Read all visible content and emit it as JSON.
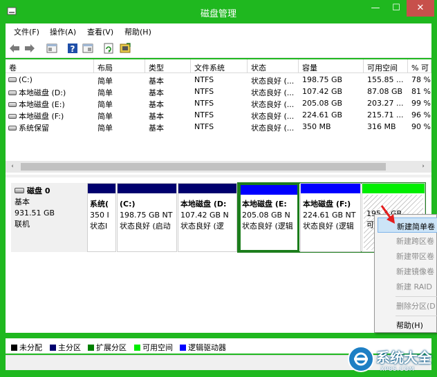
{
  "window": {
    "title": "磁盘管理",
    "controls": {
      "minimize": "—",
      "maximize": "☐",
      "close": "✕"
    }
  },
  "menu": [
    "文件(F)",
    "操作(A)",
    "查看(V)",
    "帮助(H)"
  ],
  "toolbar": {
    "icons": [
      "back-icon",
      "forward-icon",
      "properties-icon",
      "help-icon",
      "view-icon",
      "refresh-icon",
      "disk-wizard-icon"
    ]
  },
  "volume_table": {
    "headers": [
      "卷",
      "布局",
      "类型",
      "文件系统",
      "状态",
      "容量",
      "可用空间",
      "% 可"
    ],
    "rows": [
      [
        "(C:)",
        "简单",
        "基本",
        "NTFS",
        "状态良好 (...",
        "198.75 GB",
        "155.85 ...",
        "78 %"
      ],
      [
        "本地磁盘 (D:)",
        "简单",
        "基本",
        "NTFS",
        "状态良好 (...",
        "107.42 GB",
        "87.08 GB",
        "81 %"
      ],
      [
        "本地磁盘 (E:)",
        "简单",
        "基本",
        "NTFS",
        "状态良好 (...",
        "205.08 GB",
        "203.27 ...",
        "99 %"
      ],
      [
        "本地磁盘 (F:)",
        "简单",
        "基本",
        "NTFS",
        "状态良好 (...",
        "224.61 GB",
        "215.71 ...",
        "96 %"
      ],
      [
        "系统保留",
        "简单",
        "基本",
        "NTFS",
        "状态良好 (...",
        "350 MB",
        "316 MB",
        "90 %"
      ]
    ]
  },
  "scrollbar": {
    "left_arrow": "‹",
    "right_arrow": "›"
  },
  "disk": {
    "name": "磁盘 0",
    "type": "基本",
    "size": "931.51 GB",
    "status": "联机"
  },
  "partitions": [
    {
      "name": "系统(",
      "size": "350 I",
      "status": "状态Ⅰ",
      "bar_color": "#00006e"
    },
    {
      "name": "(C:)",
      "size": "198.75 GB NT",
      "status": "状态良好 (启动",
      "bar_color": "#00006e"
    },
    {
      "name": "本地磁盘 (D:",
      "size": "107.42 GB N",
      "status": "状态良好 (逻",
      "bar_color": "#00006e"
    },
    {
      "name": "本地磁盘 (E:",
      "size": "205.08 GB N",
      "status": "状态良好 (逻辑",
      "bar_color": "#0000ff"
    },
    {
      "name": "本地磁盘 (F:)",
      "size": "224.61 GB NT",
      "status": "状态良好 (逻辑",
      "bar_color": "#0000ff"
    },
    {
      "name": "",
      "size": "195.3 GB",
      "status": "可",
      "bar_color": "#00ee00"
    }
  ],
  "context_menu": {
    "items": [
      {
        "label": "新建简单卷",
        "enabled": true,
        "highlighted": true
      },
      {
        "label": "新建跨区卷",
        "enabled": false
      },
      {
        "label": "新建带区卷",
        "enabled": false
      },
      {
        "label": "新建镜像卷",
        "enabled": false
      },
      {
        "label": "新建 RAID",
        "enabled": false
      },
      {
        "label": "删除分区(D",
        "enabled": false
      },
      {
        "label": "帮助(H)",
        "enabled": true
      }
    ]
  },
  "legend": [
    {
      "label": "未分配",
      "color": "#000000"
    },
    {
      "label": "主分区",
      "color": "#00006e"
    },
    {
      "label": "扩展分区",
      "color": "#008000"
    },
    {
      "label": "可用空间",
      "color": "#00ee00"
    },
    {
      "label": "逻辑驱动器",
      "color": "#0000ff"
    }
  ],
  "watermark": {
    "text": "系统大全",
    "sub": "XP85.COM"
  }
}
